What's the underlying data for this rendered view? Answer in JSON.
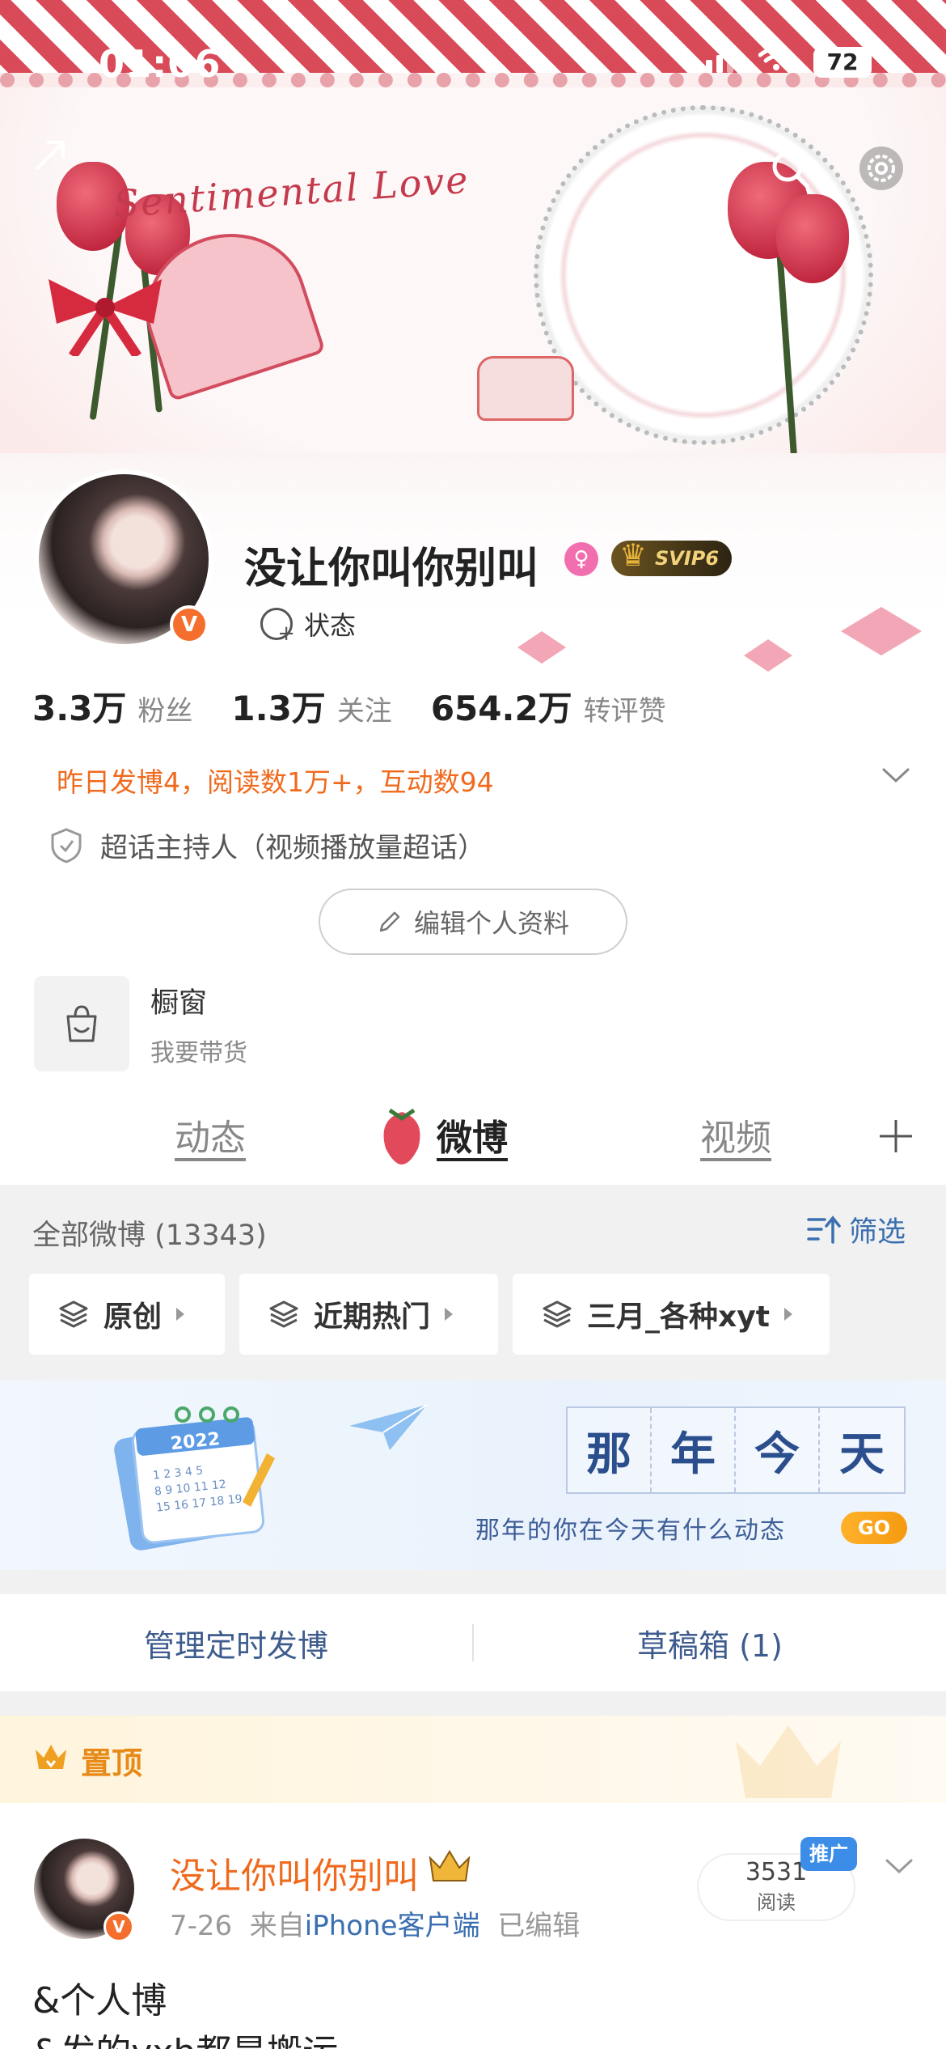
{
  "status_bar": {
    "time": "01:06",
    "battery": "72"
  },
  "banner": {
    "script_text": "Sentimental Love"
  },
  "profile": {
    "username": "没让你叫你别叫",
    "svip": "SVIP6",
    "verified_badge": "V",
    "status_label": "状态",
    "stats": [
      {
        "num": "3.3万",
        "label": "粉丝"
      },
      {
        "num": "1.3万",
        "label": "关注"
      },
      {
        "num": "654.2万",
        "label": "转评赞"
      }
    ],
    "yesterday": "昨日发博4，阅读数1万+，互动数94",
    "host": "超话主持人（视频播放量超话）",
    "edit_label": "编辑个人资料"
  },
  "shop": {
    "title": "橱窗",
    "subtitle": "我要带货"
  },
  "tabs": {
    "items": [
      "动态",
      "微博",
      "视频"
    ],
    "active": "微博"
  },
  "feed": {
    "all_label": "全部微博 (13343)",
    "filter_label": "筛选",
    "chips": [
      "原创",
      "近期热门",
      "三月_各种xyt"
    ]
  },
  "memory": {
    "title_chars": [
      "那",
      "年",
      "今",
      "天"
    ],
    "subtitle": "那年的你在今天有什么动态",
    "go": "GO",
    "calendar_year": "2022"
  },
  "actions": {
    "scheduled": "管理定时发博",
    "drafts": "草稿箱 (1)"
  },
  "pinned": {
    "label": "置顶"
  },
  "post": {
    "author": "没让你叫你别叫",
    "date": "7-26",
    "from": "来自",
    "source": "iPhone客户端",
    "edited": "已编辑",
    "reads": "3531",
    "reads_label": "阅读",
    "promo": "推广",
    "line1": "&个人博",
    "line2": "&发的yxh都是搬运"
  },
  "colors": {
    "accent_orange": "#f06a1e",
    "link_blue": "#3a6fb0",
    "banner_red": "#d53746"
  }
}
